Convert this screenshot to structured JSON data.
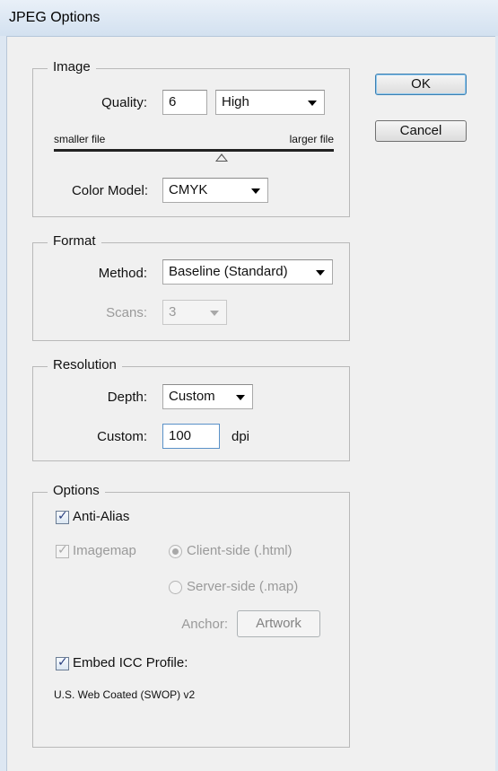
{
  "window": {
    "title": "JPEG Options"
  },
  "buttons": {
    "ok": "OK",
    "cancel": "Cancel"
  },
  "image_group": {
    "legend": "Image",
    "quality_label": "Quality:",
    "quality_value": "6",
    "quality_preset": "High",
    "smaller_label": "smaller file",
    "larger_label": "larger file",
    "quality_slider_fraction": 0.6,
    "color_model_label": "Color Model:",
    "color_model_value": "CMYK"
  },
  "format_group": {
    "legend": "Format",
    "method_label": "Method:",
    "method_value": "Baseline (Standard)",
    "scans_label": "Scans:",
    "scans_value": "3"
  },
  "resolution_group": {
    "legend": "Resolution",
    "depth_label": "Depth:",
    "depth_value": "Custom",
    "custom_label": "Custom:",
    "custom_value": "100",
    "unit": "dpi"
  },
  "options_group": {
    "legend": "Options",
    "anti_alias_label": "Anti-Alias",
    "anti_alias_checked": true,
    "imagemap_label": "Imagemap",
    "imagemap_checked": true,
    "client_side_label": "Client-side (.html)",
    "server_side_label": "Server-side (.map)",
    "anchor_label": "Anchor:",
    "anchor_button": "Artwork",
    "embed_icc_label": "Embed ICC Profile:",
    "embed_icc_checked": true,
    "icc_profile_name": "U.S. Web Coated (SWOP) v2"
  }
}
